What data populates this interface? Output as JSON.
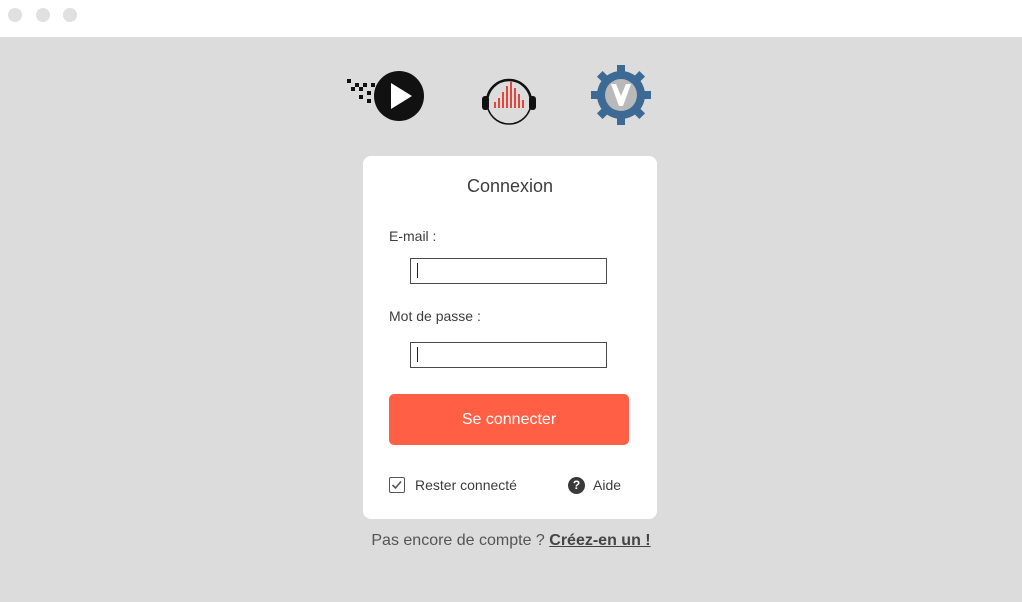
{
  "window": {
    "controls": [
      "close",
      "minimize",
      "maximize"
    ]
  },
  "logos": [
    {
      "icon": "play-logo-icon"
    },
    {
      "icon": "audio-headphones-logo-icon"
    },
    {
      "icon": "gear-v-logo-icon"
    }
  ],
  "login": {
    "title": "Connexion",
    "email_label": "E-mail :",
    "email_value": "",
    "password_label": "Mot de passe :",
    "password_value": "",
    "submit_label": "Se connecter",
    "remember_label": "Rester connecté",
    "remember_checked": true,
    "help_label": "Aide"
  },
  "footer": {
    "text": "Pas encore de compte ? ",
    "link_label": "Créez-en un !"
  },
  "colors": {
    "background": "#dcdcdc",
    "accent": "#ff5f45",
    "card": "#ffffff",
    "gear_blue": "#3d6a94"
  }
}
